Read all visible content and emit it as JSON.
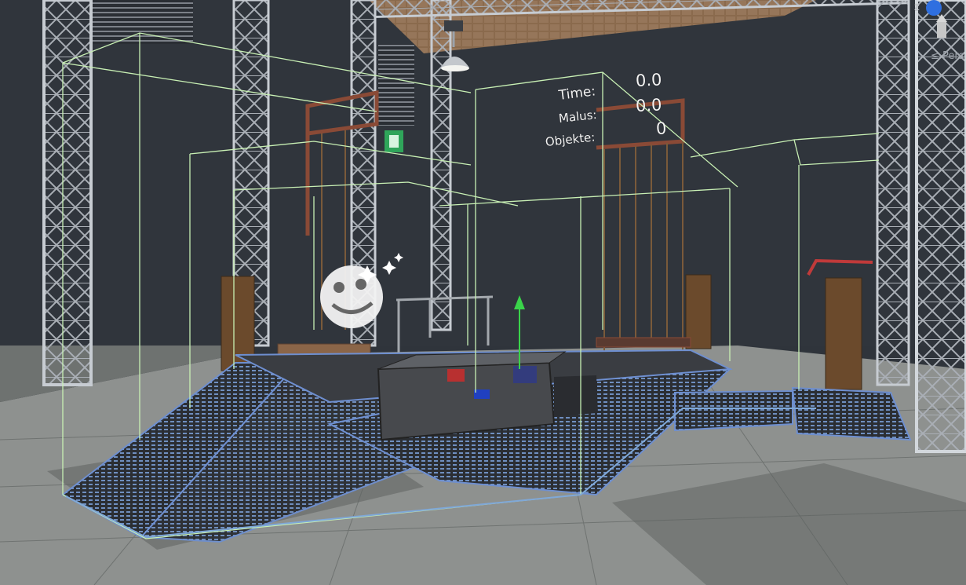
{
  "hud": {
    "time_label": "Time:",
    "time_value": "0.0",
    "malus_label": "Malus:",
    "malus_value": "0.0",
    "objekte_label": "Objekte:",
    "objekte_value": "0"
  },
  "scene_gizmo": {
    "axis_label": "z",
    "projection_label": "≤ Pers"
  },
  "colors": {
    "background": "#2f343b",
    "wall": "#30353c",
    "floor": "#8e918f",
    "bounds_green": "#c8f0b4",
    "selection_outline": "#7fa8d8",
    "truss": "#b9bec4",
    "gizmo_blue": "#2f6fe0",
    "move_handle_green": "#3ad44a"
  }
}
